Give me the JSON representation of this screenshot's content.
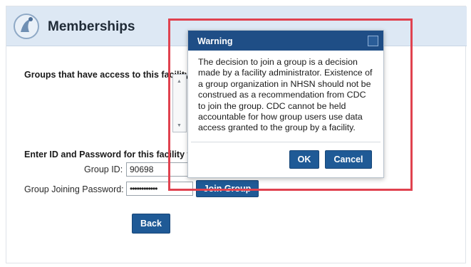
{
  "header": {
    "title": "Memberships",
    "logo_icon": "nhsn-logo-icon"
  },
  "groups_section": {
    "label": "Groups that have access to this facility's"
  },
  "join_section": {
    "label": "Enter ID and Password for this facility to",
    "group_id_label": "Group ID:",
    "group_id_value": "90698",
    "password_label": "Group Joining Password:",
    "password_value": "••••••••••••",
    "join_button": "Join Group",
    "back_button": "Back"
  },
  "modal": {
    "title": "Warning",
    "body_lines": [
      "The decision to join a group is a decision",
      "made by a facility administrator. Existence of",
      "a group organization in NHSN should not be",
      "construed as a recommendation from CDC",
      "to join the group. CDC cannot be held",
      "accountable for how group users use data",
      "access granted to the group by a facility."
    ],
    "ok_button": "OK",
    "cancel_button": "Cancel"
  },
  "colors": {
    "header_bg": "#dde8f4",
    "modal_header": "#1f4e86",
    "button": "#1f5a96",
    "highlight": "#e0424f"
  }
}
